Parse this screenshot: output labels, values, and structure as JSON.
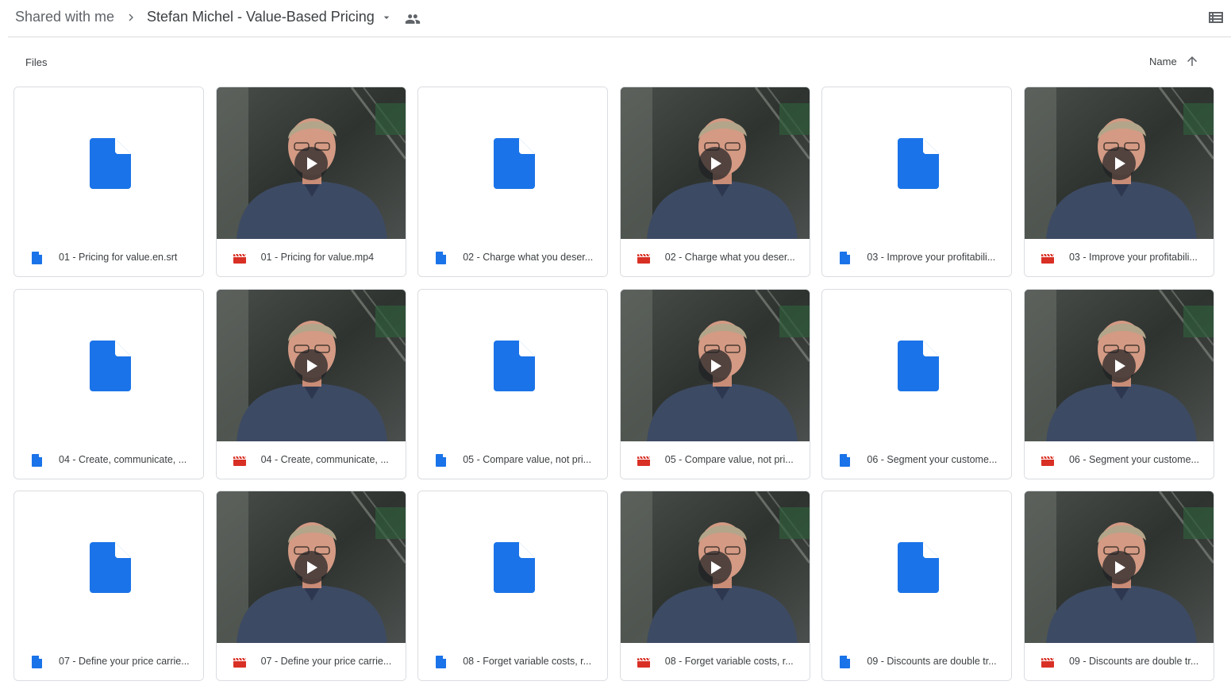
{
  "breadcrumb": {
    "root": "Shared with me",
    "current": "Stefan Michel - Value-Based Pricing"
  },
  "section": {
    "label": "Files",
    "sort_label": "Name"
  },
  "icons": {
    "separator": "chevron-right-icon",
    "caret": "caret-down-icon",
    "shared": "people-icon",
    "view": "list-view-icon",
    "sort": "arrow-up-icon",
    "doc": "google-doc-icon",
    "video": "video-clapper-icon",
    "play": "play-icon"
  },
  "colors": {
    "doc_blue": "#1a73e8",
    "video_red": "#d93025"
  },
  "files": [
    {
      "title": "01 - Pricing for value.en.srt",
      "kind": "doc"
    },
    {
      "title": "01 - Pricing for value.mp4",
      "kind": "video"
    },
    {
      "title": "02 - Charge what you deser...",
      "kind": "doc"
    },
    {
      "title": "02 - Charge what you deser...",
      "kind": "video"
    },
    {
      "title": "03 - Improve your profitabili...",
      "kind": "doc"
    },
    {
      "title": "03 - Improve your profitabili...",
      "kind": "video"
    },
    {
      "title": "04 - Create, communicate, ...",
      "kind": "doc"
    },
    {
      "title": "04 - Create, communicate, ...",
      "kind": "video"
    },
    {
      "title": "05 - Compare value, not pri...",
      "kind": "doc"
    },
    {
      "title": "05 - Compare value, not pri...",
      "kind": "video"
    },
    {
      "title": "06 - Segment your custome...",
      "kind": "doc"
    },
    {
      "title": "06 - Segment your custome...",
      "kind": "video"
    },
    {
      "title": "07 - Define your price carrie...",
      "kind": "doc"
    },
    {
      "title": "07 - Define your price carrie...",
      "kind": "video"
    },
    {
      "title": "08 - Forget variable costs, r...",
      "kind": "doc"
    },
    {
      "title": "08 - Forget variable costs, r...",
      "kind": "video"
    },
    {
      "title": "09 - Discounts are double tr...",
      "kind": "doc"
    },
    {
      "title": "09 - Discounts are double tr...",
      "kind": "video"
    }
  ]
}
